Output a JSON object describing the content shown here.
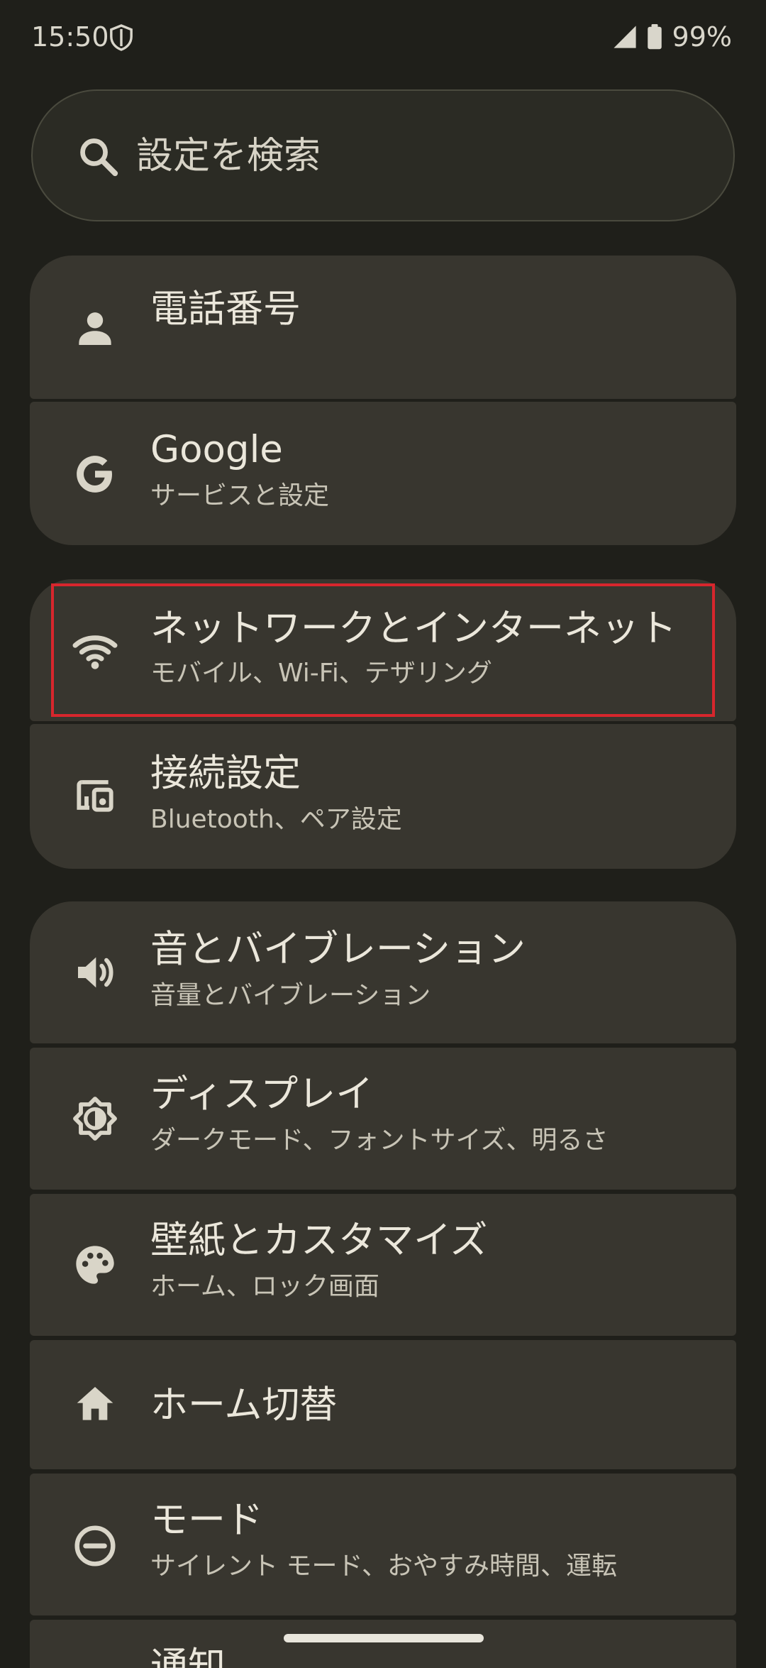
{
  "status_bar": {
    "time": "15:50",
    "battery_text": "99%",
    "icons": {
      "shield": "shield-icon",
      "signal": "cellular-signal-icon",
      "battery": "battery-icon"
    }
  },
  "search": {
    "placeholder": "設定を検索",
    "icon": "search-icon"
  },
  "settings": [
    {
      "id": "phone-number",
      "title": "電話番号",
      "subtitle": "",
      "icon": "person-icon"
    },
    {
      "id": "google",
      "title": "Google",
      "subtitle": "サービスと設定",
      "icon": "google-g-icon"
    },
    {
      "id": "network-internet",
      "title": "ネットワークとインターネット",
      "subtitle": "モバイル、Wi-Fi、テザリング",
      "icon": "wifi-icon"
    },
    {
      "id": "connection",
      "title": "接続設定",
      "subtitle": "Bluetooth、ペア設定",
      "icon": "devices-icon"
    },
    {
      "id": "sound",
      "title": "音とバイブレーション",
      "subtitle": "音量とバイブレーション",
      "icon": "volume-icon"
    },
    {
      "id": "display",
      "title": "ディスプレイ",
      "subtitle": "ダークモード、フォントサイズ、明るさ",
      "icon": "brightness-icon"
    },
    {
      "id": "wallpaper",
      "title": "壁紙とカスタマイズ",
      "subtitle": "ホーム、ロック画面",
      "icon": "palette-icon"
    },
    {
      "id": "home-switch",
      "title": "ホーム切替",
      "subtitle": "",
      "icon": "home-icon"
    },
    {
      "id": "modes",
      "title": "モード",
      "subtitle": "サイレント モード、おやすみ時間、運転",
      "icon": "do-not-disturb-icon"
    },
    {
      "id": "notifications",
      "title": "通知",
      "subtitle": "",
      "icon": "notification-icon"
    }
  ],
  "highlight": {
    "target": "network-internet",
    "color": "#d7262d"
  },
  "colors": {
    "background": "#1f1f1a",
    "card": "#38362f",
    "search_background": "#2b2b24",
    "text_primary": "#ebe7db",
    "text_secondary": "#c8c4b6"
  }
}
